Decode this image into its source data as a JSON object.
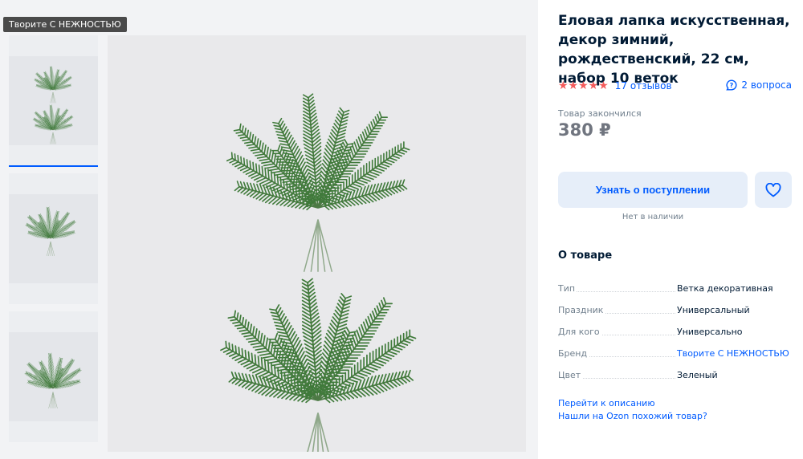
{
  "brand_tag": "Творите С НЕЖНОСТЬЮ",
  "product": {
    "title": "Еловая лапка искусственная, декор зимний, рождественский, 22 см, набор 10 веток",
    "stars": "★★★★★",
    "reviews": "17 отзывов",
    "questions": "2 вопроса",
    "stock_note": "Товар закончился",
    "price": "380 ₽",
    "notify_label": "Узнать о поступлении",
    "availability": "Нет в наличии"
  },
  "about": {
    "title": "О товаре",
    "props": [
      {
        "key": "Тип",
        "value": "Ветка декоративная"
      },
      {
        "key": "Праздник",
        "value": "Универсальный"
      },
      {
        "key": "Для кого",
        "value": "Универсально"
      },
      {
        "key": "Бренд",
        "value": "Творите С НЕЖНОСТЬЮ"
      },
      {
        "key": "Цвет",
        "value": "Зеленый"
      }
    ],
    "link_description": "Перейти к описанию",
    "link_similar": "Нашли на Ozon похожий товар?"
  },
  "colors": {
    "accent": "#005bff",
    "stars": "#f45b5b",
    "foliage": "#3f7a3a"
  },
  "icons": {
    "questions": "chat-question-icon",
    "favorite": "heart-icon"
  }
}
